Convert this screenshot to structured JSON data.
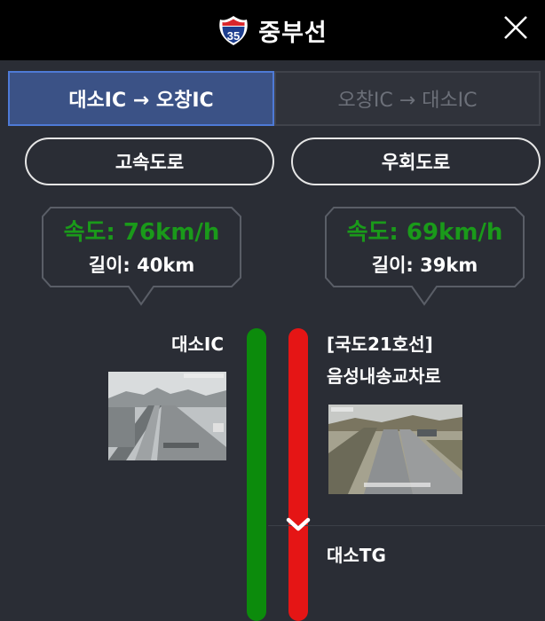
{
  "header": {
    "route_number": "35",
    "title": "중부선",
    "close_icon": "close-icon"
  },
  "tabs": [
    {
      "label": "대소IC → 오창IC",
      "active": true
    },
    {
      "label": "오창IC → 대소IC",
      "active": false
    }
  ],
  "roads": {
    "highway_label": "고속도로",
    "detour_label": "우회도로"
  },
  "highway_info": {
    "speed": "속도: 76km/h",
    "length": "길이: 40km",
    "status_color": "#0c8b0c"
  },
  "detour_info": {
    "speed": "속도: 69km/h",
    "length": "길이: 39km",
    "status_color": "#e51515"
  },
  "nodes": {
    "start_label": "대소IC",
    "route_name": "[국도21호선]",
    "route_point": "음성내송교차로",
    "tg_label": "대소TG"
  },
  "colors": {
    "accent": "#3b5286",
    "speed_text": "#1a9a1a"
  }
}
